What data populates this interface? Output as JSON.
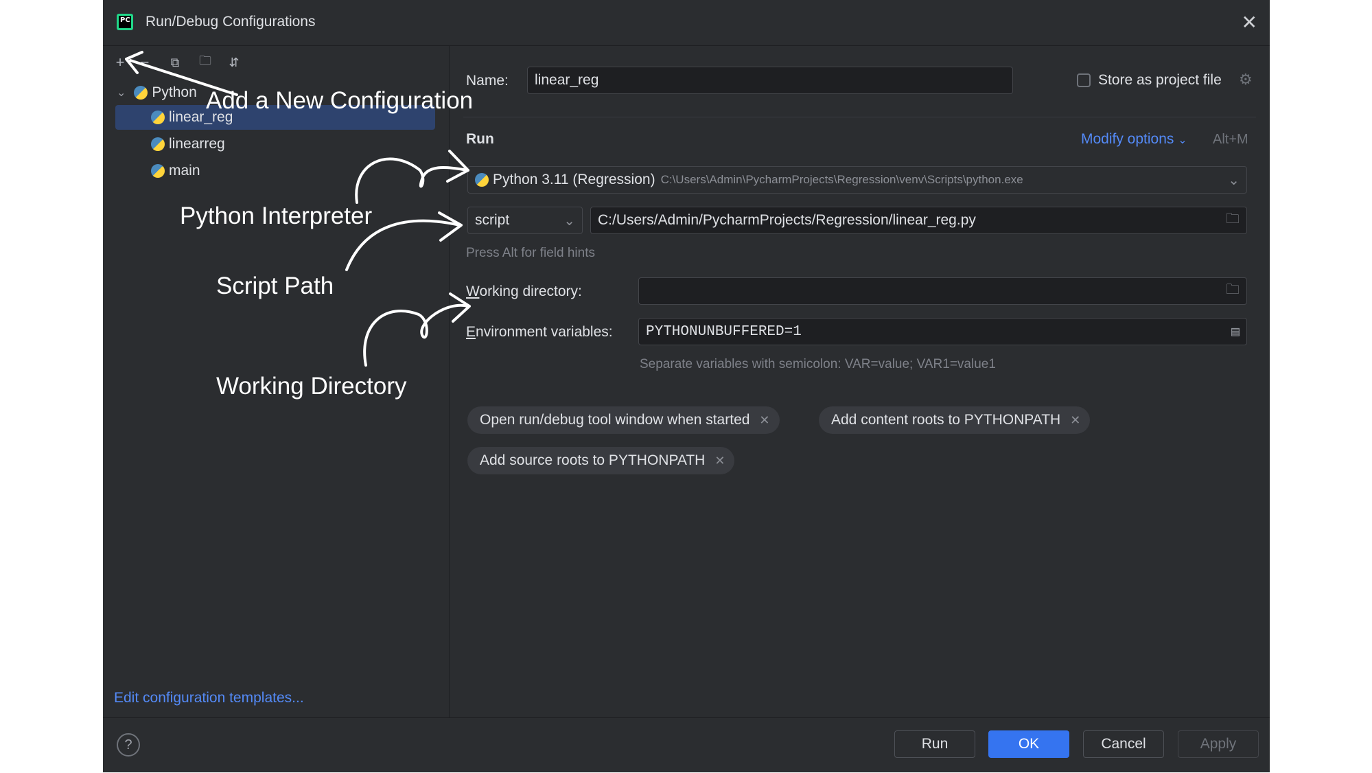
{
  "window": {
    "title": "Run/Debug Configurations",
    "app_icon": "PC"
  },
  "toolbar": {
    "add_icon": "plus-icon",
    "remove_icon": "minus-icon",
    "copy_icon": "copy-icon",
    "folder_icon": "new-folder-icon",
    "sort_icon": "sort-icon"
  },
  "tree": {
    "group": "Python",
    "items": [
      {
        "label": "linear_reg",
        "selected": true
      },
      {
        "label": "linearreg",
        "selected": false
      },
      {
        "label": "main",
        "selected": false
      }
    ]
  },
  "left_footer": {
    "templates_link": "Edit configuration templates..."
  },
  "form": {
    "name_label": "Name:",
    "name_value": "linear_reg",
    "store_label": "Store as project file",
    "run_section": "Run",
    "modify_options": "Modify options",
    "modify_shortcut": "Alt+M",
    "interpreter_name": "Python 3.11 (Regression)",
    "interpreter_path": "C:\\Users\\Admin\\PycharmProjects\\Regression\\venv\\Scripts\\python.exe",
    "script_type": "script",
    "script_path": "C:/Users/Admin/PycharmProjects/Regression/linear_reg.py",
    "field_hint": "Press Alt for field hints",
    "working_dir_label": "Working directory:",
    "working_dir_value": "",
    "env_label": "Environment variables:",
    "env_value": "PYTHONUNBUFFERED=1",
    "env_hint": "Separate variables with semicolon: VAR=value; VAR1=value1",
    "tags": [
      "Open run/debug tool window when started",
      "Add content roots to PYTHONPATH",
      "Add source roots to PYTHONPATH"
    ]
  },
  "footer": {
    "help": "?",
    "run": "Run",
    "ok": "OK",
    "cancel": "Cancel",
    "apply": "Apply"
  },
  "annotations": {
    "new_config": "Add a New Configuration",
    "interpreter": "Python Interpreter",
    "script_path": "Script Path",
    "working_dir": "Working Directory"
  },
  "colors": {
    "dialog_bg": "#2b2d30",
    "field_bg": "#1e1f22",
    "accent": "#3574f0",
    "link": "#548af7",
    "selection": "#2e436e"
  }
}
